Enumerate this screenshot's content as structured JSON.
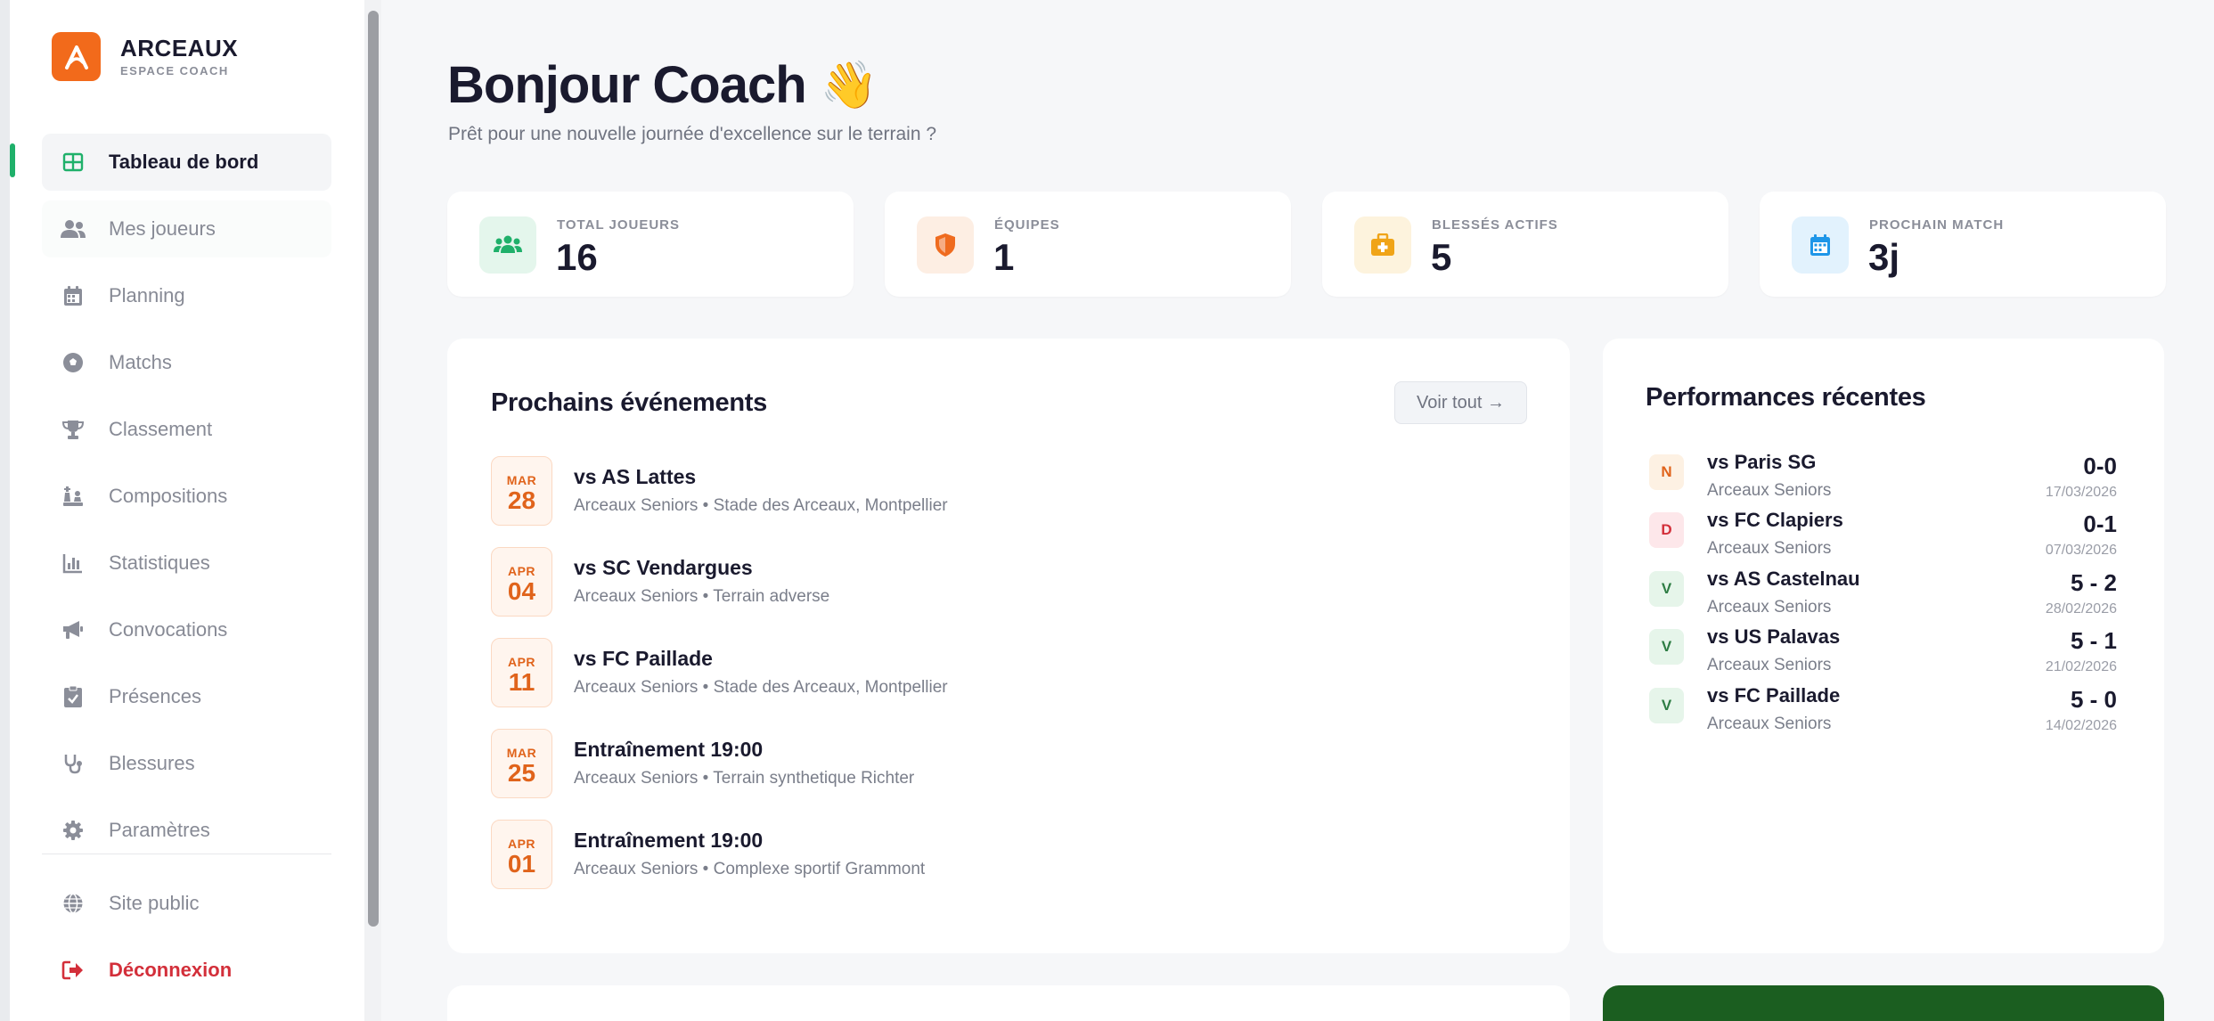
{
  "brand": {
    "name": "ARCEAUX",
    "subtitle": "ESPACE COACH",
    "color": "#f26a1b"
  },
  "nav": {
    "items": [
      {
        "label": "Tableau de bord",
        "icon": "grid-icon",
        "active": true
      },
      {
        "label": "Mes joueurs",
        "icon": "users-icon"
      },
      {
        "label": "Planning",
        "icon": "calendar-icon"
      },
      {
        "label": "Matchs",
        "icon": "soccer-ball-icon"
      },
      {
        "label": "Classement",
        "icon": "trophy-icon"
      },
      {
        "label": "Compositions",
        "icon": "chess-icon"
      },
      {
        "label": "Statistiques",
        "icon": "bar-chart-icon"
      },
      {
        "label": "Convocations",
        "icon": "megaphone-icon"
      },
      {
        "label": "Présences",
        "icon": "clipboard-check-icon"
      },
      {
        "label": "Blessures",
        "icon": "stethoscope-icon"
      },
      {
        "label": "Paramètres",
        "icon": "gear-icon"
      }
    ],
    "bottom": [
      {
        "label": "Site public",
        "icon": "globe-icon"
      },
      {
        "label": "Déconnexion",
        "icon": "logout-icon"
      }
    ]
  },
  "header": {
    "title": "Bonjour Coach",
    "emoji": "👋",
    "subtitle": "Prêt pour une nouvelle journée d'excellence sur le terrain ?"
  },
  "stats": [
    {
      "label": "TOTAL JOUEURS",
      "value": "16",
      "icon": "users-icon",
      "color": "#1fb06a",
      "bg": "#e4f6ec"
    },
    {
      "label": "ÉQUIPES",
      "value": "1",
      "icon": "shield-icon",
      "color": "#ef6b1f",
      "bg": "#fdeee3"
    },
    {
      "label": "BLESSÉS ACTIFS",
      "value": "5",
      "icon": "medkit-icon",
      "color": "#f0a417",
      "bg": "#fdf3dd"
    },
    {
      "label": "PROCHAIN MATCH",
      "value": "3j",
      "icon": "calendar-icon",
      "color": "#1e96e8",
      "bg": "#e2f2fd"
    }
  ],
  "events": {
    "title": "Prochains événements",
    "see_all": "Voir tout →",
    "items": [
      {
        "month": "MAR",
        "day": "28",
        "title": "vs AS Lattes",
        "sub": "Arceaux Seniors • Stade des Arceaux, Montpellier"
      },
      {
        "month": "APR",
        "day": "04",
        "title": "vs SC Vendargues",
        "sub": "Arceaux Seniors • Terrain adverse"
      },
      {
        "month": "APR",
        "day": "11",
        "title": "vs FC Paillade",
        "sub": "Arceaux Seniors • Stade des Arceaux, Montpellier"
      },
      {
        "month": "MAR",
        "day": "25",
        "title": "Entraînement 19:00",
        "sub": "Arceaux Seniors • Terrain synthetique Richter"
      },
      {
        "month": "APR",
        "day": "01",
        "title": "Entraînement 19:00",
        "sub": "Arceaux Seniors • Complexe sportif Grammont"
      }
    ]
  },
  "performances": {
    "title": "Performances récentes",
    "items": [
      {
        "result": "N",
        "kind": "n",
        "title": "vs Paris SG",
        "team": "Arceaux Seniors",
        "score": "0-0",
        "date": "17/03/2026"
      },
      {
        "result": "D",
        "kind": "d",
        "title": "vs FC Clapiers",
        "team": "Arceaux Seniors",
        "score": "0-1",
        "date": "07/03/2026"
      },
      {
        "result": "V",
        "kind": "v",
        "title": "vs AS Castelnau",
        "team": "Arceaux Seniors",
        "score": "5 - 2",
        "date": "28/02/2026"
      },
      {
        "result": "V",
        "kind": "v",
        "title": "vs US Palavas",
        "team": "Arceaux Seniors",
        "score": "5 - 1",
        "date": "21/02/2026"
      },
      {
        "result": "V",
        "kind": "v",
        "title": "vs FC Paillade",
        "team": "Arceaux Seniors",
        "score": "5 - 0",
        "date": "14/02/2026"
      }
    ]
  }
}
